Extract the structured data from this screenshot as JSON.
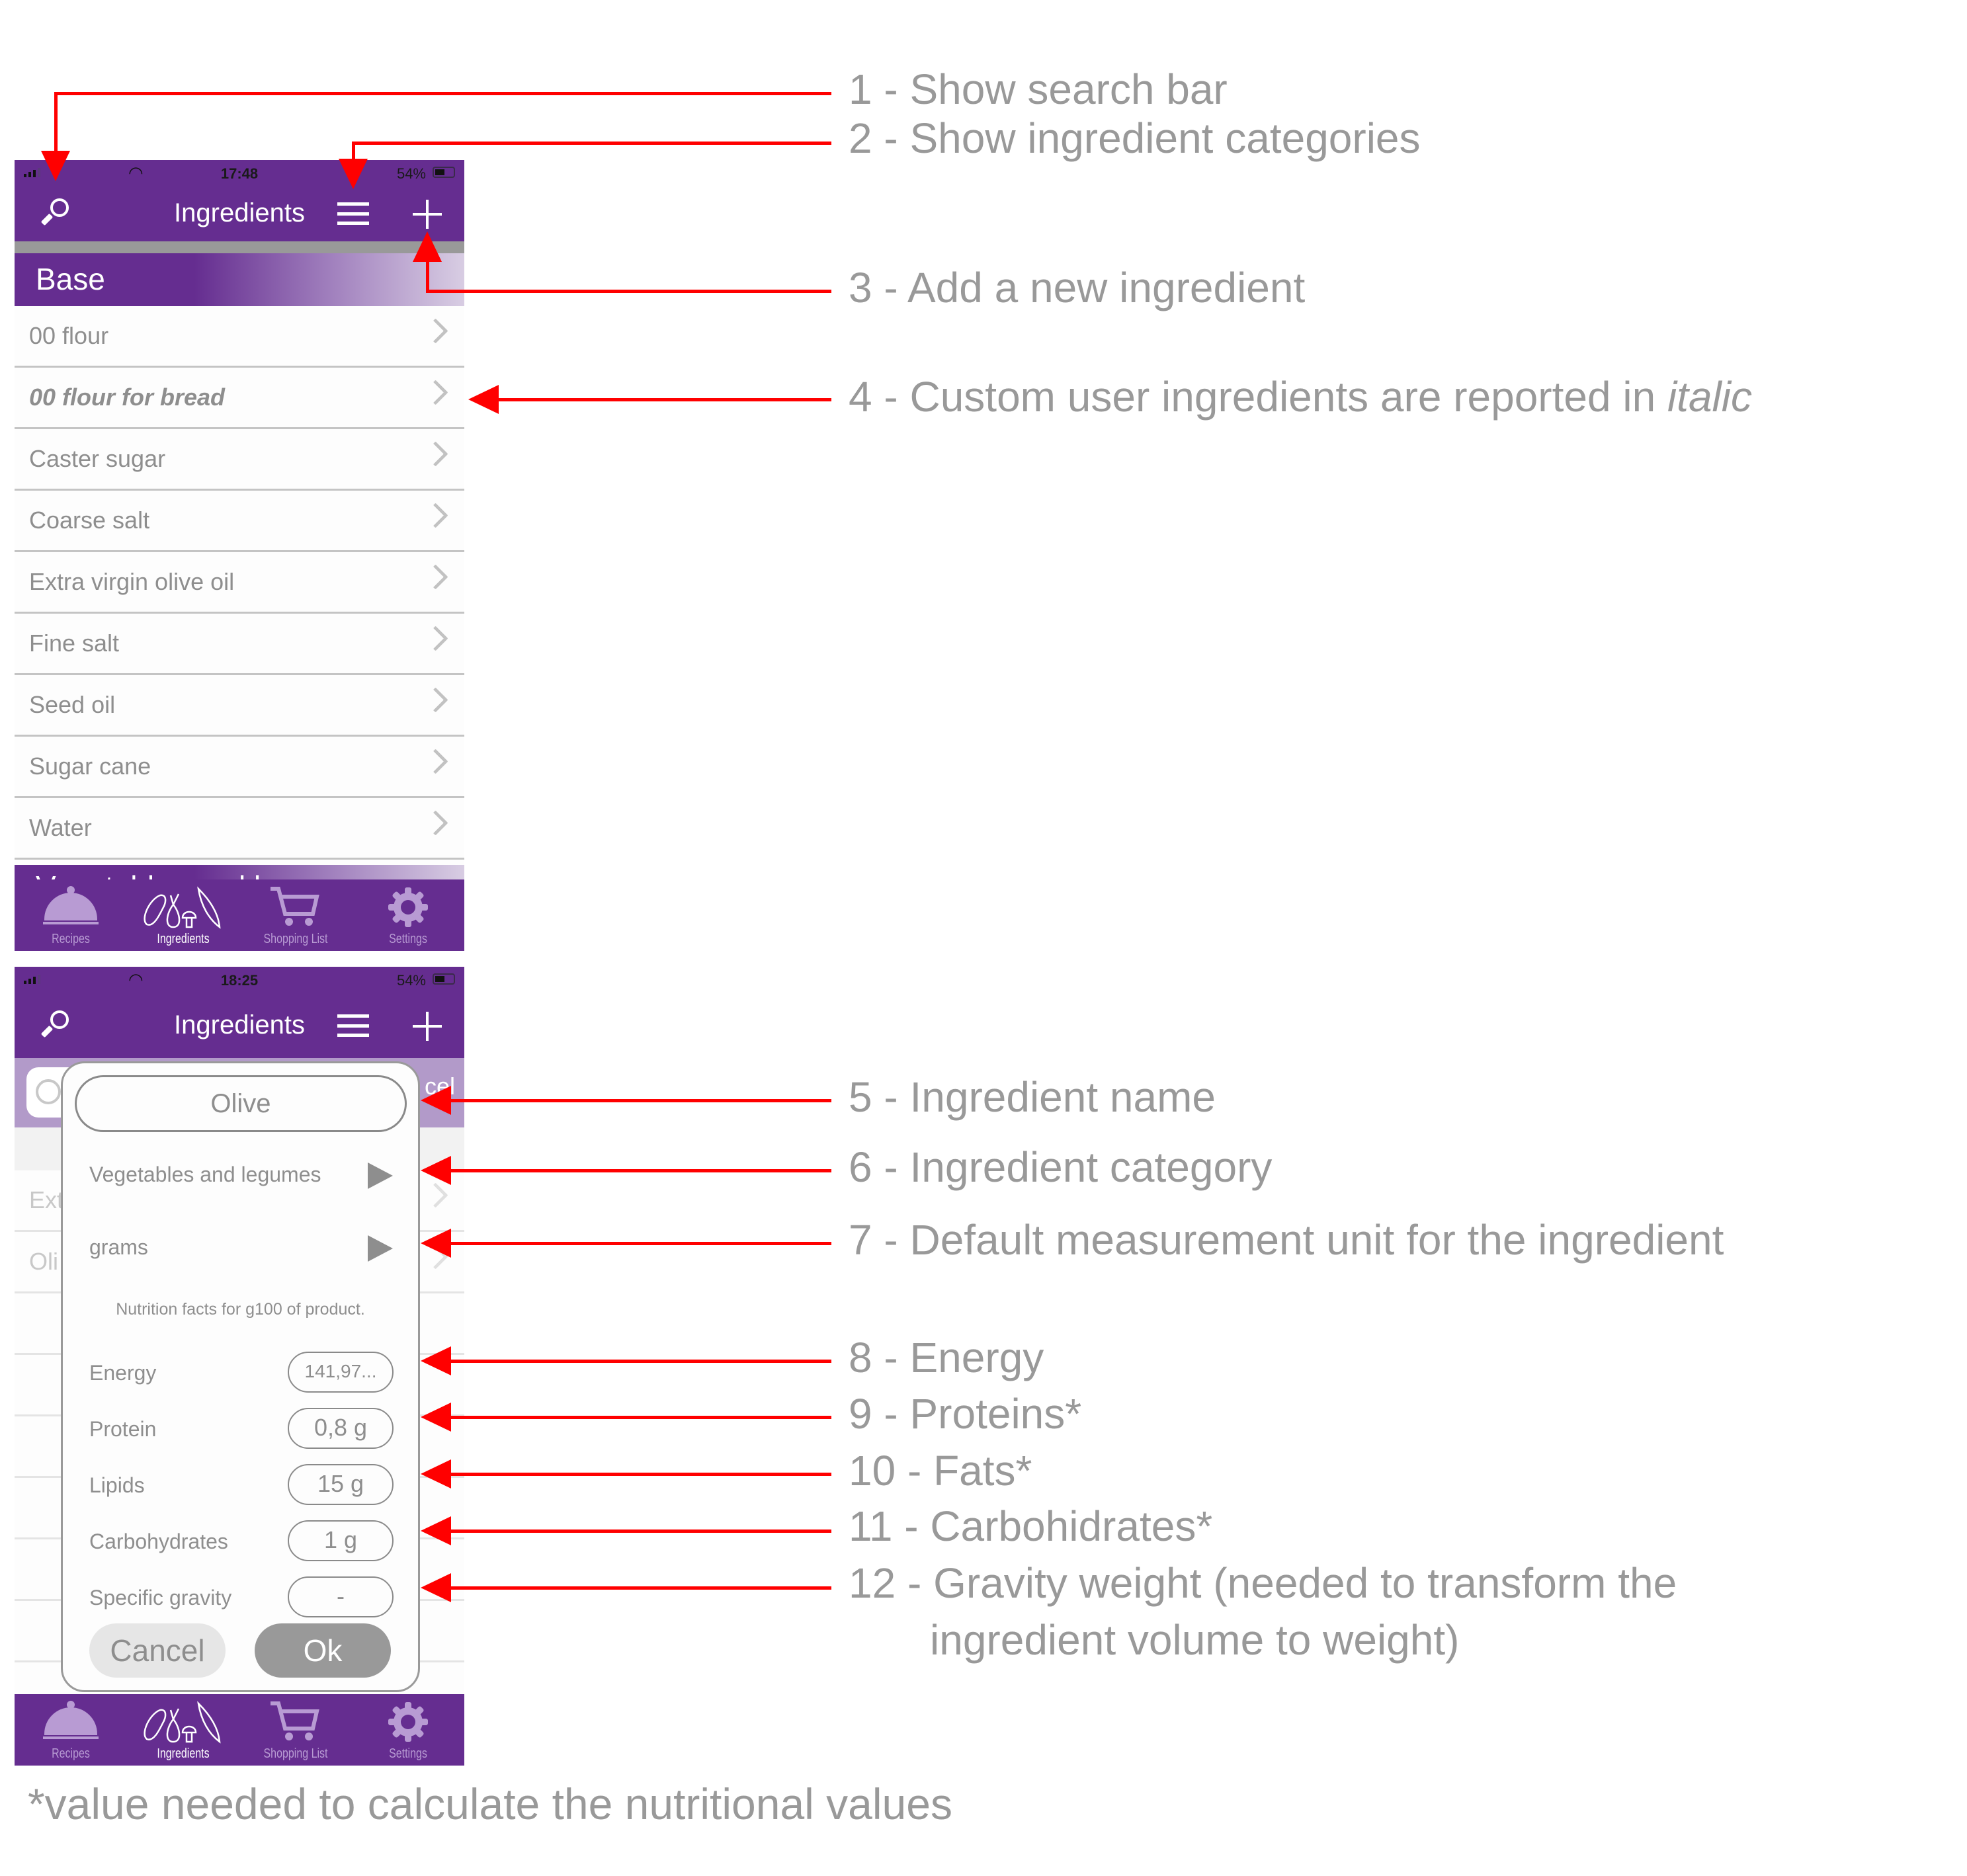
{
  "screen1": {
    "status": {
      "time": "17:48",
      "battery": "54%"
    },
    "header": {
      "title": "Ingredients"
    },
    "section": "Base",
    "items": [
      {
        "name": "00 flour",
        "custom": false
      },
      {
        "name": "00 flour for bread",
        "custom": true
      },
      {
        "name": "Caster sugar",
        "custom": false
      },
      {
        "name": "Coarse salt",
        "custom": false
      },
      {
        "name": "Extra virgin olive oil",
        "custom": false
      },
      {
        "name": "Fine salt",
        "custom": false
      },
      {
        "name": "Seed oil",
        "custom": false
      },
      {
        "name": "Sugar cane",
        "custom": false
      },
      {
        "name": "Water",
        "custom": false
      }
    ],
    "next_section": "Vegetables and legumes"
  },
  "screen2": {
    "status": {
      "time": "18:25",
      "battery": "54%"
    },
    "header": {
      "title": "Ingredients"
    },
    "search_cancel_partial": "cel",
    "behind_rows": [
      "Ext",
      "Oli"
    ],
    "modal": {
      "name": "Olive",
      "category": "Vegetables and legumes",
      "unit": "grams",
      "nutrition_note": "Nutrition facts for g100 of product.",
      "fields": [
        {
          "label": "Energy",
          "value": "141,97..."
        },
        {
          "label": "Protein",
          "value": "0,8 g"
        },
        {
          "label": "Lipids",
          "value": "15 g"
        },
        {
          "label": "Carbohydrates",
          "value": "1 g"
        },
        {
          "label": "Specific gravity",
          "value": "-"
        }
      ],
      "cancel": "Cancel",
      "ok": "Ok"
    }
  },
  "tabbar": {
    "tabs": [
      {
        "label": "Recipes",
        "icon": "cloche-icon",
        "active": false
      },
      {
        "label": "Ingredients",
        "icon": "vegetables-icon",
        "active": true
      },
      {
        "label": "Shopping List",
        "icon": "cart-icon",
        "active": false
      },
      {
        "label": "Settings",
        "icon": "gear-icon",
        "active": false
      }
    ]
  },
  "annotations": {
    "a1": "1 - Show search bar",
    "a2": "2 - Show ingredient categories",
    "a3": "3 - Add a new ingredient",
    "a4_prefix": "4 - Custom user ingredients are reported in ",
    "a4_italic": "italic",
    "a5": "5 - Ingredient name",
    "a6": "6 - Ingredient category",
    "a7": "7 - Default measurement unit for the ingredient",
    "a8": "8 - Energy",
    "a9": "9 - Proteins*",
    "a10": "10 - Fats*",
    "a11": "11 - Carbohidrates*",
    "a12_line1": "12 - Gravity weight (needed to transform the",
    "a12_line2": "ingredient volume to weight)"
  },
  "footnote": "*value needed to calculate the nutritional values",
  "colors": {
    "brand_purple": "#652d90",
    "annotation_red": "#ff0000",
    "annotation_text": "#999999"
  }
}
